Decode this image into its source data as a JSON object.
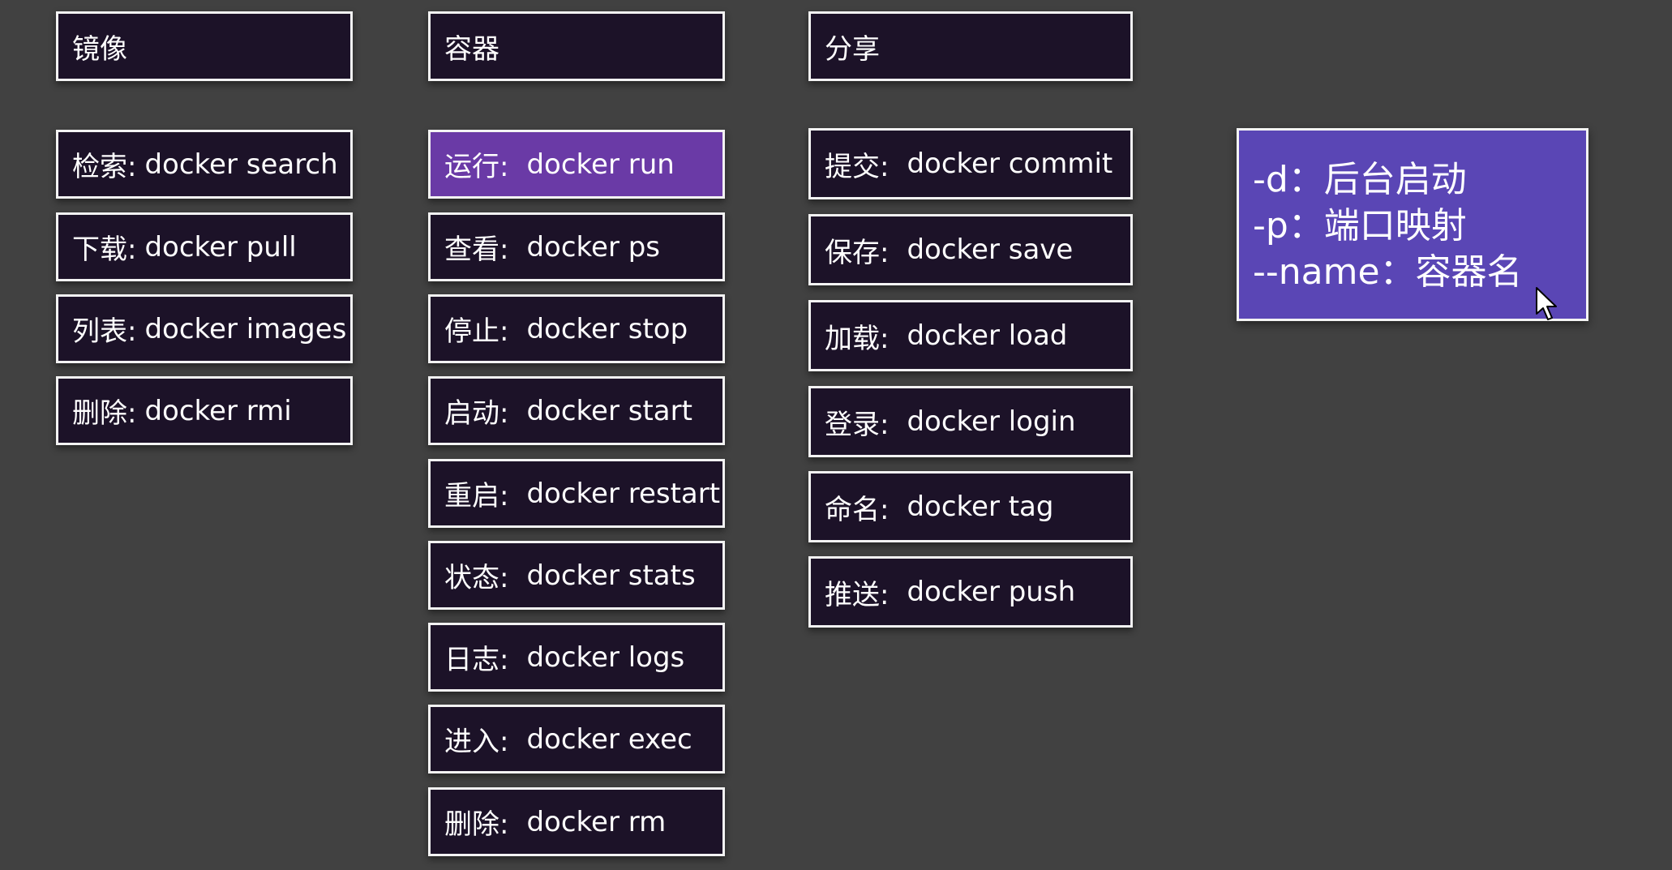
{
  "columns": {
    "image": {
      "header": "镜像",
      "items": [
        {
          "label": "检索:",
          "command": "docker search"
        },
        {
          "label": "下载:",
          "command": "docker pull"
        },
        {
          "label": "列表:",
          "command": "docker images"
        },
        {
          "label": "删除:",
          "command": "docker rmi"
        }
      ]
    },
    "container": {
      "header": "容器",
      "items": [
        {
          "label": "运行:",
          "command": "docker run",
          "active": true
        },
        {
          "label": "查看:",
          "command": "docker ps"
        },
        {
          "label": "停止:",
          "command": "docker stop"
        },
        {
          "label": "启动:",
          "command": "docker start"
        },
        {
          "label": "重启:",
          "command": "docker restart"
        },
        {
          "label": "状态:",
          "command": "docker stats"
        },
        {
          "label": "日志:",
          "command": "docker logs"
        },
        {
          "label": "进入:",
          "command": "docker exec"
        },
        {
          "label": "删除:",
          "command": "docker rm"
        }
      ]
    },
    "share": {
      "header": "分享",
      "items": [
        {
          "label": "提交:",
          "command": "docker commit"
        },
        {
          "label": "保存:",
          "command": "docker save"
        },
        {
          "label": "加载:",
          "command": "docker load"
        },
        {
          "label": "登录:",
          "command": "docker login"
        },
        {
          "label": "命名:",
          "command": "docker tag"
        },
        {
          "label": "推送:",
          "command": "docker push"
        }
      ]
    }
  },
  "note": {
    "lines": [
      "-d：后台启动",
      "-p：端口映射",
      "--name：容器名"
    ]
  },
  "colors": {
    "background": "#414141",
    "box_fill": "#1c1228",
    "box_border": "#f3f3f3",
    "active_fill": "#6a3aa6",
    "note_fill": "#5a46b5",
    "text": "#ffffff"
  },
  "icons": {
    "cursor": "mouse-pointer-icon"
  }
}
